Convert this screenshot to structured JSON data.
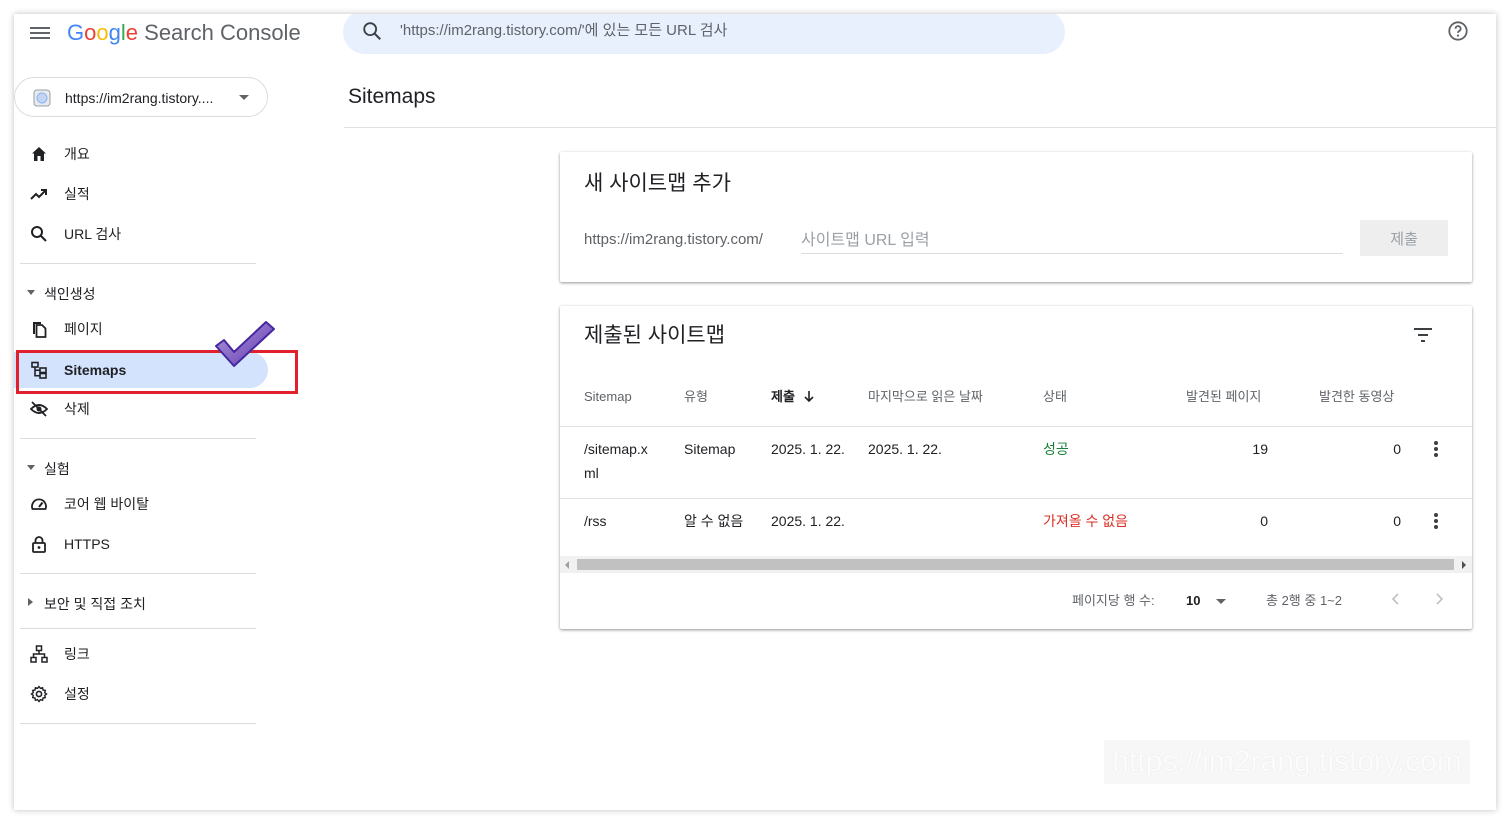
{
  "header": {
    "logo_letters": [
      "G",
      "o",
      "o",
      "g",
      "l",
      "e"
    ],
    "product": "Search Console",
    "search_placeholder": "'https://im2rang.tistory.com/'에 있는 모든 URL 검사"
  },
  "property": {
    "label": "https://im2rang.tistory...."
  },
  "sidebar": {
    "overview": "개요",
    "performance": "실적",
    "url_inspection": "URL 검사",
    "indexing_section": "색인생성",
    "pages": "페이지",
    "sitemaps": "Sitemaps",
    "removals": "삭제",
    "experience_section": "실험",
    "core_web_vitals": "코어 웹 바이탈",
    "https": "HTTPS",
    "security_section": "보안 및 직접 조치",
    "links": "링크",
    "settings": "설정"
  },
  "main": {
    "page_title": "Sitemaps",
    "add_card": {
      "title": "새 사이트맵 추가",
      "prefix": "https://im2rang.tistory.com/",
      "input_placeholder": "사이트맵 URL 입력",
      "submit_label": "제출"
    },
    "submitted_card": {
      "title": "제출된 사이트맵",
      "columns": {
        "sitemap": "Sitemap",
        "type": "유형",
        "submitted": "제출",
        "last_read": "마지막으로 읽은 날짜",
        "status": "상태",
        "discovered_pages": "발견된 페이지",
        "discovered_videos": "발견한 동영상"
      },
      "rows": [
        {
          "sitemap_l1": "/sitemap.x",
          "sitemap_l2": "ml",
          "type": "Sitemap",
          "submitted": "2025. 1. 22.",
          "last_read": "2025. 1. 22.",
          "status": "성공",
          "pages": "19",
          "videos": "0"
        },
        {
          "sitemap_l1": "/rss",
          "sitemap_l2": "",
          "type": "알 수 없음",
          "submitted": "2025. 1. 22.",
          "last_read": "",
          "status": "가져올 수 없음",
          "pages": "0",
          "videos": "0"
        }
      ],
      "pager": {
        "rows_per_page_label": "페이지당 행 수:",
        "rows_per_page": "10",
        "range": "총 2행 중 1~2"
      }
    }
  },
  "watermark": "https://im2rang.tistory.com",
  "colors": {
    "accent": "#d3e3fd",
    "success": "#188038",
    "error": "#d93025",
    "highlight": "#e0202c"
  }
}
